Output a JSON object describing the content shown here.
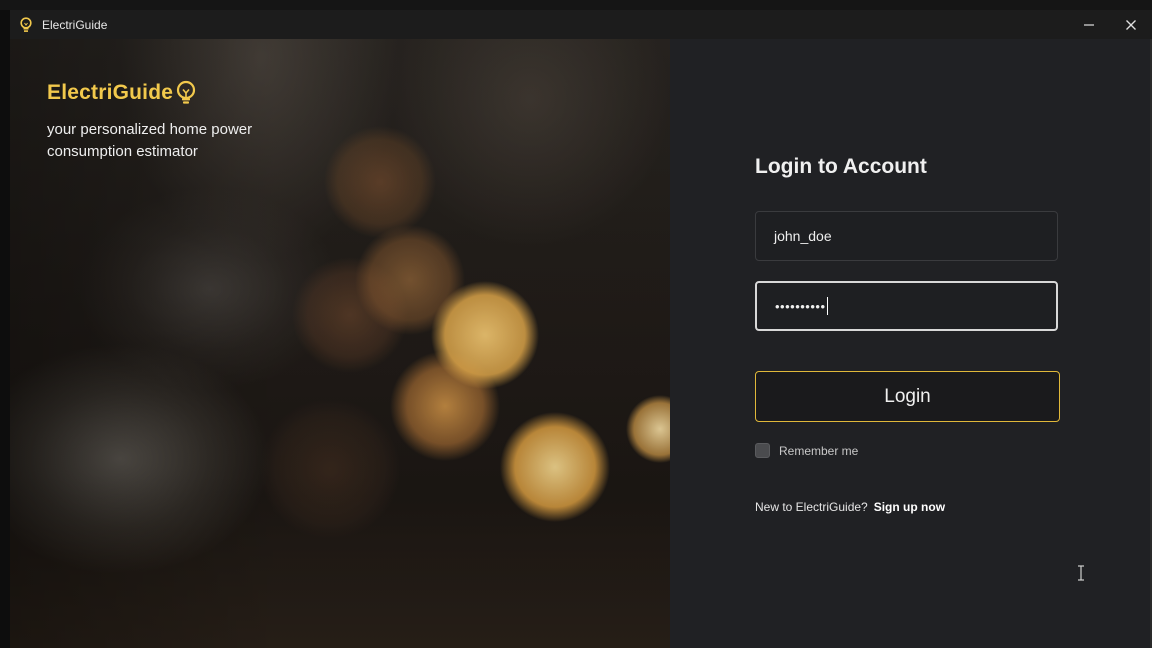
{
  "window": {
    "title": "ElectriGuide",
    "minimize_icon": "minimize-icon",
    "close_icon": "close-icon"
  },
  "hero": {
    "brand_name": "ElectriGuide",
    "brand_icon": "lightbulb-icon",
    "tagline": "your personalized home power consumption estimator"
  },
  "login": {
    "title": "Login to Account",
    "username_value": "john_doe",
    "password_value": "••••••••••",
    "login_label": "Login",
    "remember_label": "Remember me",
    "remember_checked": false,
    "signup_prompt": "New to ElectriGuide?",
    "signup_link": "Sign up now"
  },
  "colors": {
    "accent": "#f2c94c",
    "button_border": "#e0b83a",
    "panel_bg": "#202124",
    "titlebar_bg": "#1c1c1c"
  }
}
